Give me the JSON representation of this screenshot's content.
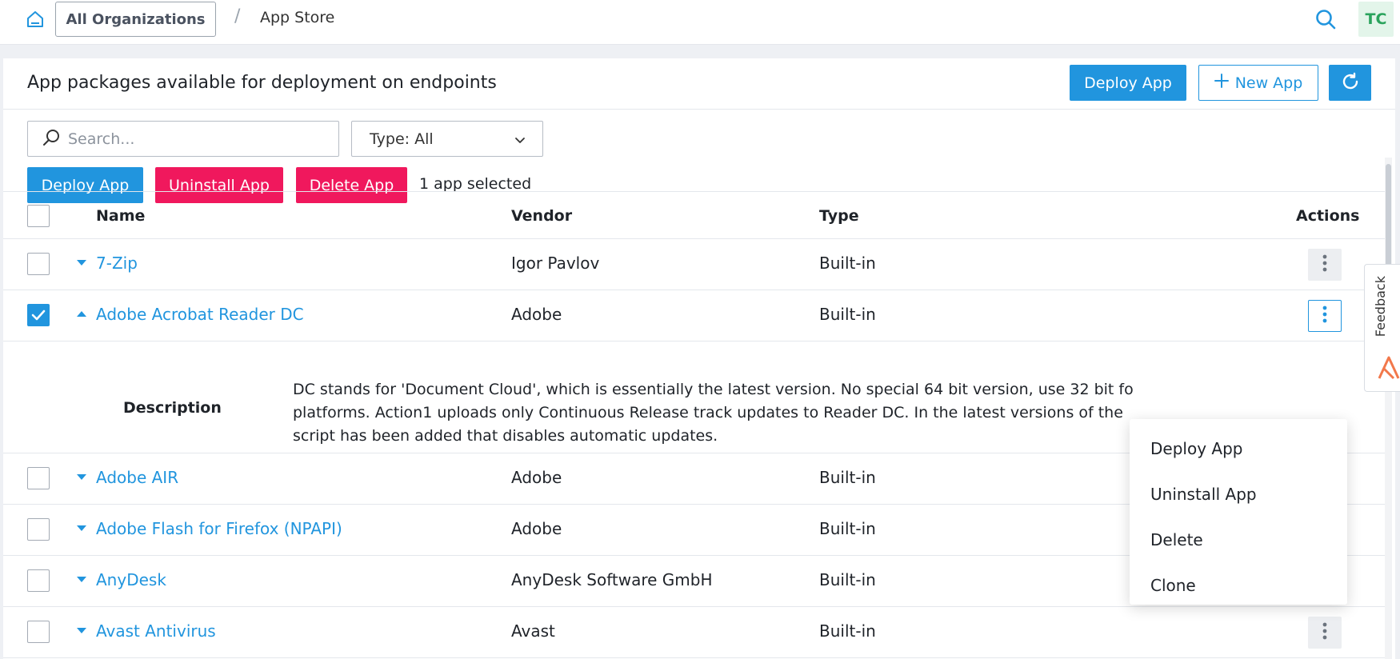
{
  "topbar": {
    "org_button": "All Organizations",
    "separator": "/",
    "current_page": "App Store",
    "avatar_initials": "TC"
  },
  "panel": {
    "title": "App packages available for deployment on endpoints",
    "deploy_label": "Deploy App",
    "new_app_label": "New App"
  },
  "filters": {
    "search_placeholder": "Search...",
    "type_label": "Type: All"
  },
  "bulk_actions": {
    "deploy": "Deploy App",
    "uninstall": "Uninstall App",
    "delete": "Delete App",
    "selected_count": "1 app selected"
  },
  "table": {
    "columns": {
      "name": "Name",
      "vendor": "Vendor",
      "type": "Type",
      "actions": "Actions"
    },
    "rows": [
      {
        "name": "7-Zip",
        "vendor": "Igor Pavlov",
        "type": "Built-in"
      },
      {
        "name": "Adobe Acrobat Reader DC",
        "vendor": "Adobe",
        "type": "Built-in"
      },
      {
        "name": "Adobe AIR",
        "vendor": "Adobe",
        "type": "Built-in"
      },
      {
        "name": "Adobe Flash for Firefox (NPAPI)",
        "vendor": "Adobe",
        "type": "Built-in"
      },
      {
        "name": "AnyDesk",
        "vendor": "AnyDesk Software GmbH",
        "type": "Built-in"
      },
      {
        "name": "Avast Antivirus",
        "vendor": "Avast",
        "type": "Built-in"
      }
    ],
    "description": {
      "label": "Description",
      "line1": "DC stands for 'Document Cloud', which is essentially the latest version. No special 64 bit version, use 32 bit fo",
      "line2": "platforms. Action1 uploads only Continuous Release track updates to Reader DC. In the latest versions of the",
      "line3": "script has been added that disables automatic updates."
    }
  },
  "context_menu": {
    "items": [
      "Deploy App",
      "Uninstall App",
      "Delete",
      "Clone"
    ]
  },
  "feedback": {
    "label": "Feedback"
  },
  "colors": {
    "primary": "#2195de",
    "danger": "#f0185d",
    "avatar_bg": "#e3f5ea",
    "avatar_fg": "#2aa35c"
  }
}
